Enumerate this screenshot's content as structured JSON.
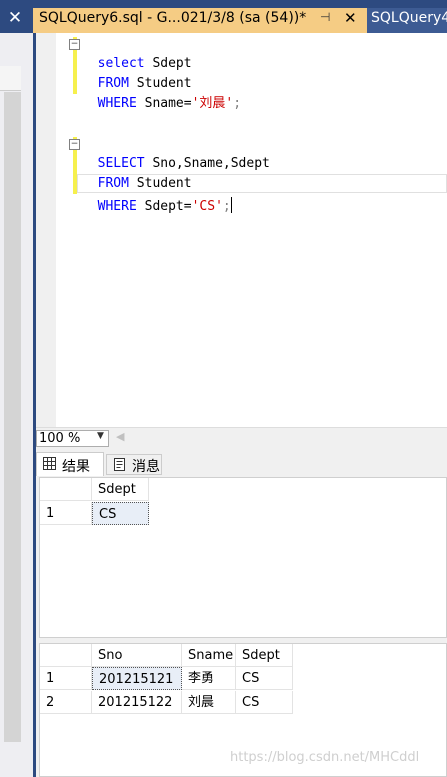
{
  "tabs": {
    "active_title": "SQLQuery6.sql - G...021/3/8 (sa (54))*",
    "inactive_title": "SQLQuery4",
    "pin_icon": "pin-icon",
    "close_icon": "close-icon"
  },
  "editor": {
    "lines": [
      {
        "kw": "select",
        "rest": " Sdept"
      },
      {
        "kw": "FROM",
        "rest": " Student"
      },
      {
        "kw": "WHERE",
        "rest": " Sname=",
        "str": "'刘晨'",
        "tail": ";"
      },
      {
        "kw": "SELECT",
        "rest": " Sno,Sname,Sdept"
      },
      {
        "kw": "FROM",
        "rest": " Student"
      },
      {
        "kw": "WHERE",
        "rest": " Sdept=",
        "str": "'CS'",
        "tail": ";"
      }
    ]
  },
  "zoom": {
    "value": "100 %"
  },
  "results_tabs": {
    "results_label": "结果",
    "messages_label": "消息"
  },
  "grid1": {
    "columns": [
      "Sdept"
    ],
    "rows": [
      {
        "num": "1",
        "cells": [
          "CS"
        ]
      }
    ]
  },
  "grid2": {
    "columns": [
      "Sno",
      "Sname",
      "Sdept"
    ],
    "rows": [
      {
        "num": "1",
        "cells": [
          "201215121",
          "李勇",
          "CS"
        ]
      },
      {
        "num": "2",
        "cells": [
          "201215122",
          "刘晨",
          "CS"
        ]
      }
    ]
  },
  "watermark": "https://blog.csdn.net/MHCddl",
  "colors": {
    "tab_bar": "#2d4a80",
    "active_tab": "#f5cc84",
    "keyword": "#0000ff",
    "string": "#cc0000"
  }
}
